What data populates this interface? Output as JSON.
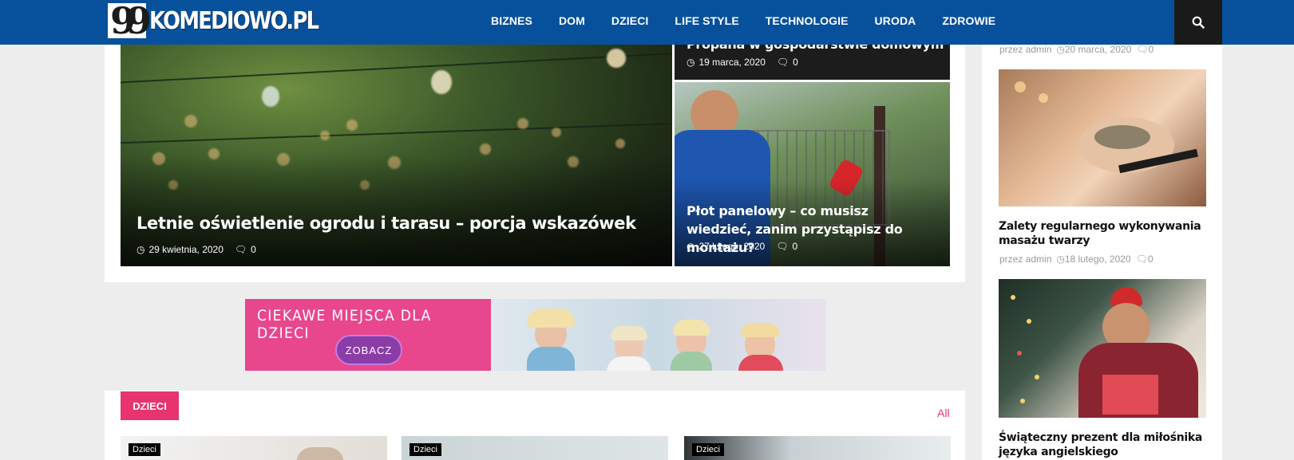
{
  "header": {
    "logo_text": "KOMEDIOWO.PL",
    "brand_color": "#07519c",
    "nav": [
      "BIZNES",
      "DOM",
      "DZIECI",
      "LIFE STYLE",
      "TECHNOLOGIE",
      "URODA",
      "ZDROWIE"
    ],
    "search_icon": "search-icon"
  },
  "featured": {
    "main": {
      "title": "Letnie oświetlenie ogrodu i tarasu – porcja wskazówek",
      "date": "29 kwietnia, 2020",
      "comments": "0"
    },
    "side_top": {
      "title": "Propana w gospodarstwie domowym",
      "date": "19 marca, 2020",
      "comments": "0"
    },
    "side_bottom": {
      "title": "Płot panelowy – co musisz wiedzieć, zanim przystąpisz do montażu?",
      "date": "27 lutego, 2020",
      "comments": "0"
    }
  },
  "banner": {
    "text": "CIEKAWE MIEJSCA DLA DZIECI",
    "button": "ZOBACZ",
    "bg_color": "#e8468d"
  },
  "category": {
    "label": "DZIECI",
    "all_link": "All",
    "accent": "#e8346e",
    "cards": [
      {
        "tag": "Dzieci"
      },
      {
        "tag": "Dzieci"
      },
      {
        "tag": "Dzieci"
      }
    ]
  },
  "sidebar": {
    "posts": [
      {
        "author": "przez admin",
        "date": "20 marca, 2020",
        "comments": "0"
      },
      {
        "title": "Zalety regularnego wykonywania masażu twarzy",
        "author": "przez admin",
        "date": "18 lutego, 2020",
        "comments": "0"
      },
      {
        "title": "Świąteczny prezent dla miłośnika języka angielskiego"
      }
    ]
  }
}
